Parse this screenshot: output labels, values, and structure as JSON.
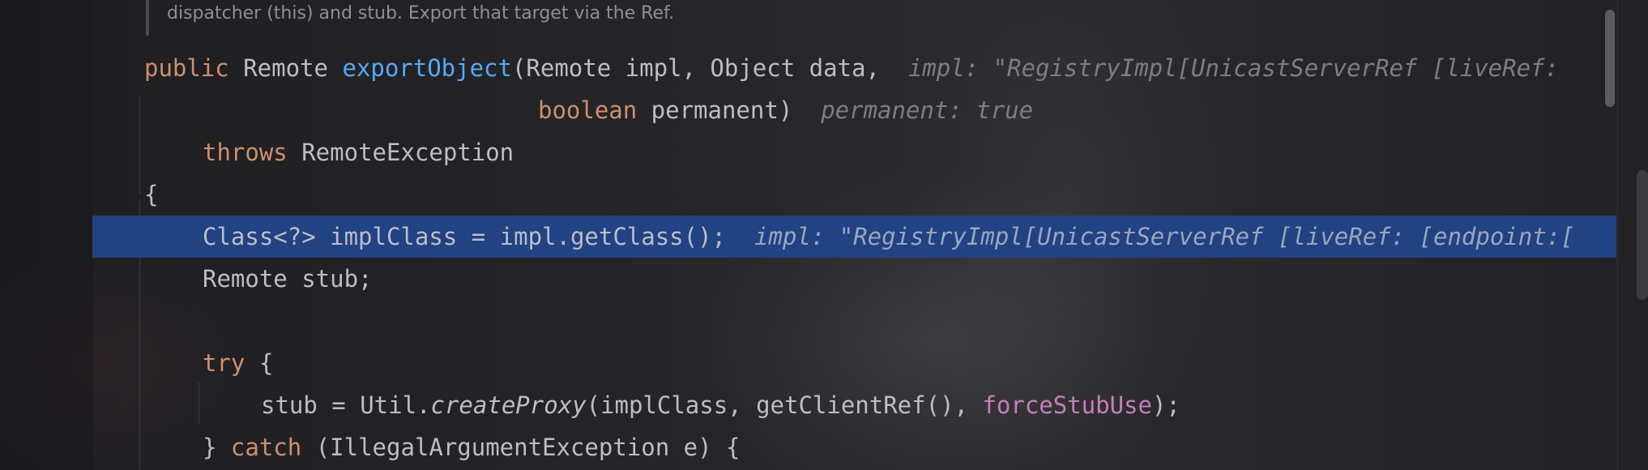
{
  "doc_comment": "dispatcher (this) and stub. Export that target via the Ref.",
  "lines": {
    "l1": {
      "kw_public": "public",
      "type_remote": " Remote ",
      "method": "exportObject",
      "params": "(Remote impl, Object data,",
      "hint": "impl: \"RegistryImpl[UnicastServerRef [liveRef:"
    },
    "l2": {
      "kw_boolean": "boolean",
      "rest": " permanent)",
      "hint": "permanent: true"
    },
    "l3": {
      "kw_throws": "throws",
      "rest": " RemoteException"
    },
    "l4": {
      "brace": "{"
    },
    "l5": {
      "code": "Class<?> implClass = impl.getClass();",
      "hint": "impl: \"RegistryImpl[UnicastServerRef [liveRef: [endpoint:["
    },
    "l6": {
      "code": "Remote stub;"
    },
    "l8": {
      "kw_try": "try",
      "rest": " {"
    },
    "l9": {
      "pre": "stub = Util.",
      "call": "createProxy",
      "mid": "(implClass, getClientRef(), ",
      "field": "forceStubUse",
      "post": ");"
    },
    "l10": {
      "pre": "} ",
      "kw_catch": "catch",
      "rest": " (IllegalArgumentException e) {"
    }
  },
  "colors": {
    "keyword": "#cf8e6d",
    "method": "#56a8f5",
    "field": "#c77dbb",
    "text": "#bcbec4",
    "hint": "#7a7e85",
    "selection": "#214283"
  }
}
